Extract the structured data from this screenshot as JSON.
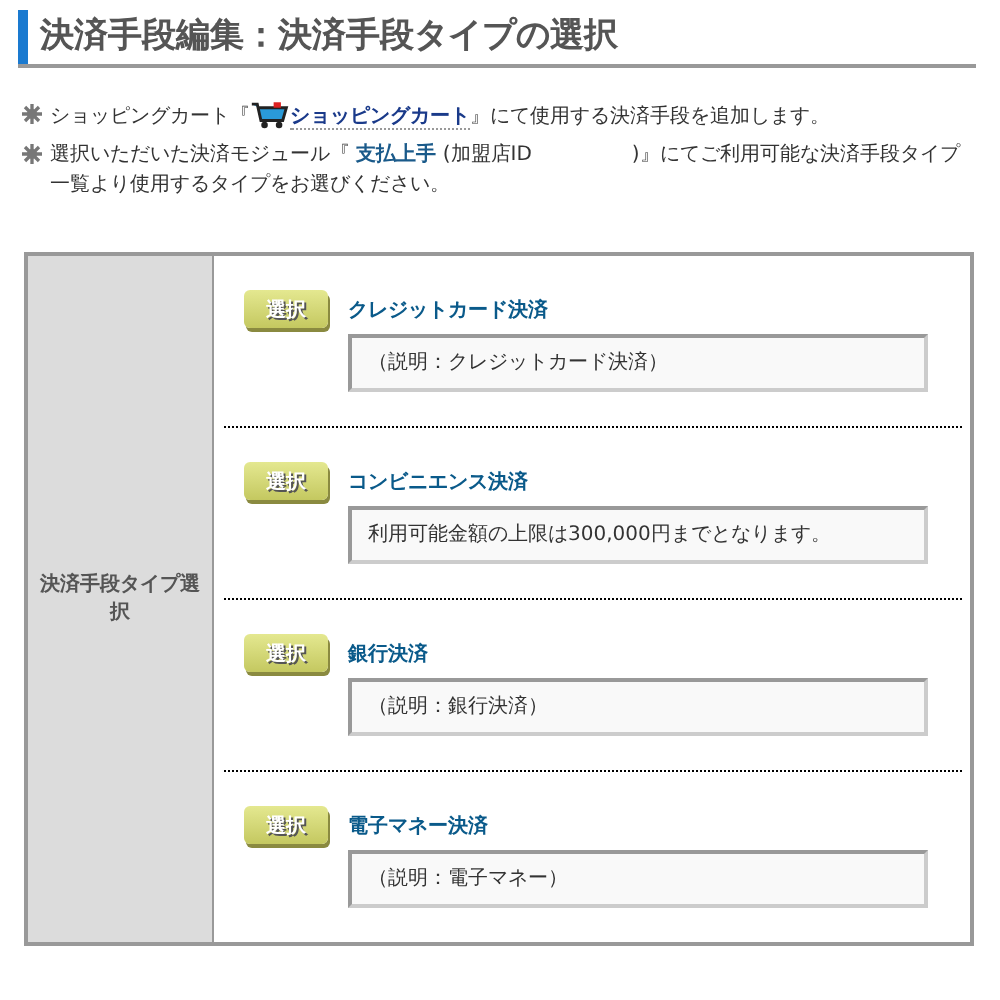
{
  "title": "決済手段編集：決済手段タイプの選択",
  "notes": [
    {
      "before": "ショッピングカート『",
      "icon": true,
      "link": "ショッピングカート",
      "after": "』にて使用する決済手段を追加します。"
    },
    {
      "before": "選択いただいた決済モジュール『 ",
      "icon": false,
      "link": "支払上手",
      "after": " (加盟店ID　　　　　)』にてご利用可能な決済手段タイプ一覧より使用するタイプをお選びください。"
    }
  ],
  "table": {
    "label": "決済手段タイプ選択",
    "methods": [
      {
        "button": "選択",
        "name": "クレジットカード決済",
        "description": "（説明：クレジットカード決済）"
      },
      {
        "button": "選択",
        "name": "コンビニエンス決済",
        "description": "利用可能金額の上限は300,000円までとなります。"
      },
      {
        "button": "選択",
        "name": "銀行決済",
        "description": "（説明：銀行決済）"
      },
      {
        "button": "選択",
        "name": "電子マネー決済",
        "description": "（説明：電子マネー）"
      }
    ]
  }
}
